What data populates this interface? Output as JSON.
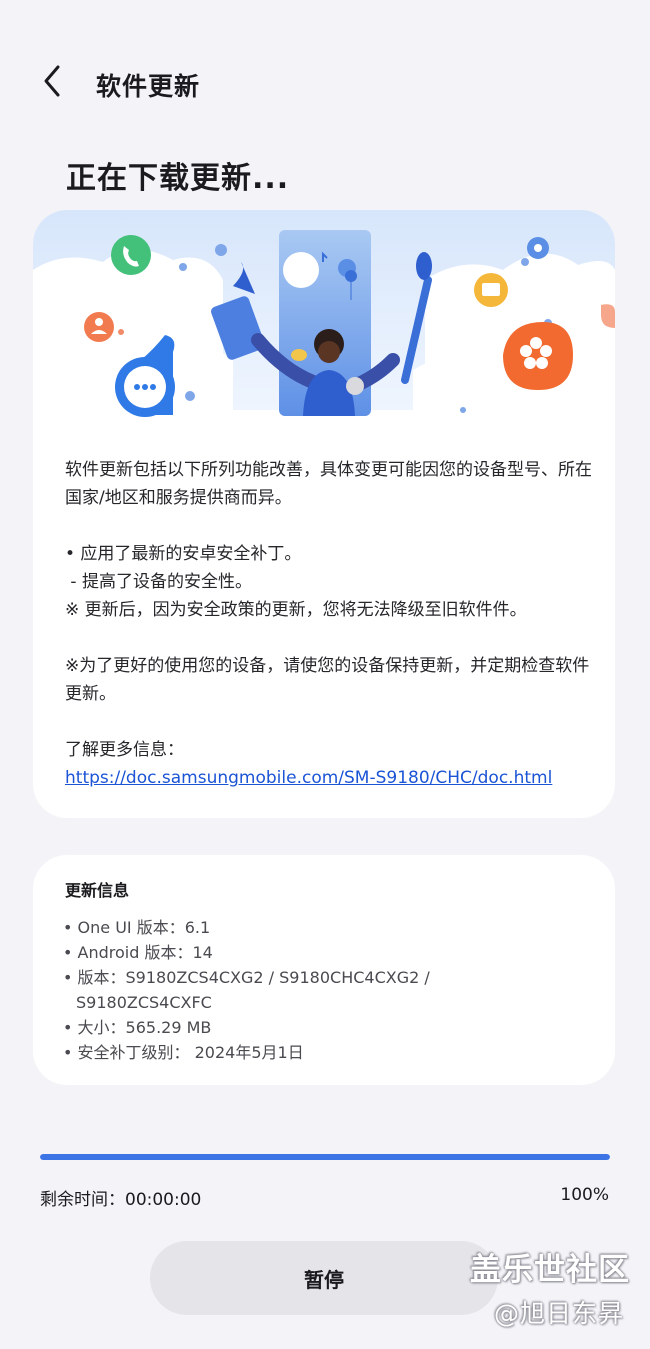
{
  "header": {
    "title": "软件更新"
  },
  "heading": "正在下载更新...",
  "description": {
    "intro": "软件更新包括以下所列功能改善，具体变更可能因您的设备型号、所在国家/地区和服务提供商而异。",
    "bullet1": "• 应用了最新的安卓安全补丁。",
    "bullet1_sub": " - 提高了设备的安全性。",
    "note1": "※ 更新后，因为安全政策的更新，您将无法降级至旧软件件。",
    "note2": "※为了更好的使用您的设备，请使您的设备保持更新，并定期检查软件更新。",
    "more_info_label": "了解更多信息：",
    "more_info_link": "https://doc.samsungmobile.com/SM-S9180/CHC/doc.html"
  },
  "update_info": {
    "title": "更新信息",
    "one_ui": "• One UI 版本：6.1",
    "android": "• Android 版本：14",
    "build_line1": "• 版本：S9180ZCS4CXG2 / S9180CHC4CXG2 /",
    "build_line2": "S9180ZCS4CXFC",
    "size": "• 大小：565.29 MB",
    "patch": "• 安全补丁级别： 2024年5月1日"
  },
  "progress": {
    "value": 1.0,
    "remaining_label": "剩余时间：00:00:00",
    "percent_label": "100%"
  },
  "pause_label": "暂停",
  "watermark": {
    "line1": "盖乐世社区",
    "line2": "@旭日东昇"
  },
  "icons": [
    "back-arrow-icon",
    "phone-icon",
    "chat-icon",
    "person-icon",
    "folder-icon",
    "settings-gear-icon",
    "flower-icon"
  ],
  "colors": {
    "accent": "#3c74e6",
    "link": "#1c54d6",
    "background": "#f4f4f8",
    "card": "#ffffff"
  }
}
